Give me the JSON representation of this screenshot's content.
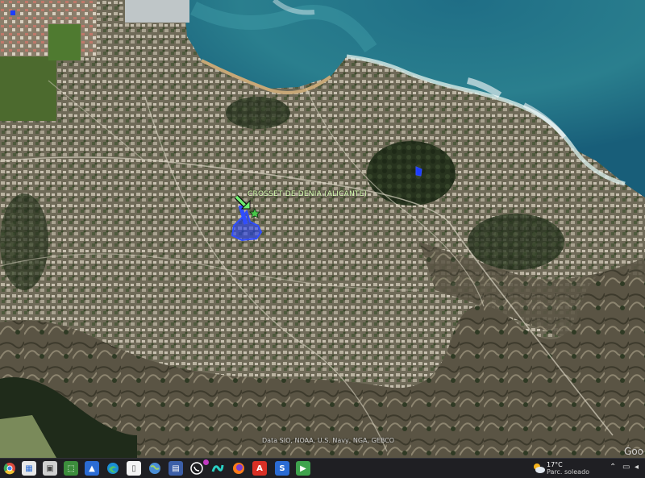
{
  "map": {
    "placemark_label": "CROSSET DE DENIA (ALICANTE)",
    "attribution": "Data SIO, NOAA, U.S. Navy, NGA, GEBCO",
    "logo_text": "Goo"
  },
  "taskbar": {
    "weather_temp": "17°C",
    "weather_desc": "Parc. soleado",
    "colors": {
      "background": "#1f1f23",
      "accent": "#2b6cd4"
    }
  }
}
